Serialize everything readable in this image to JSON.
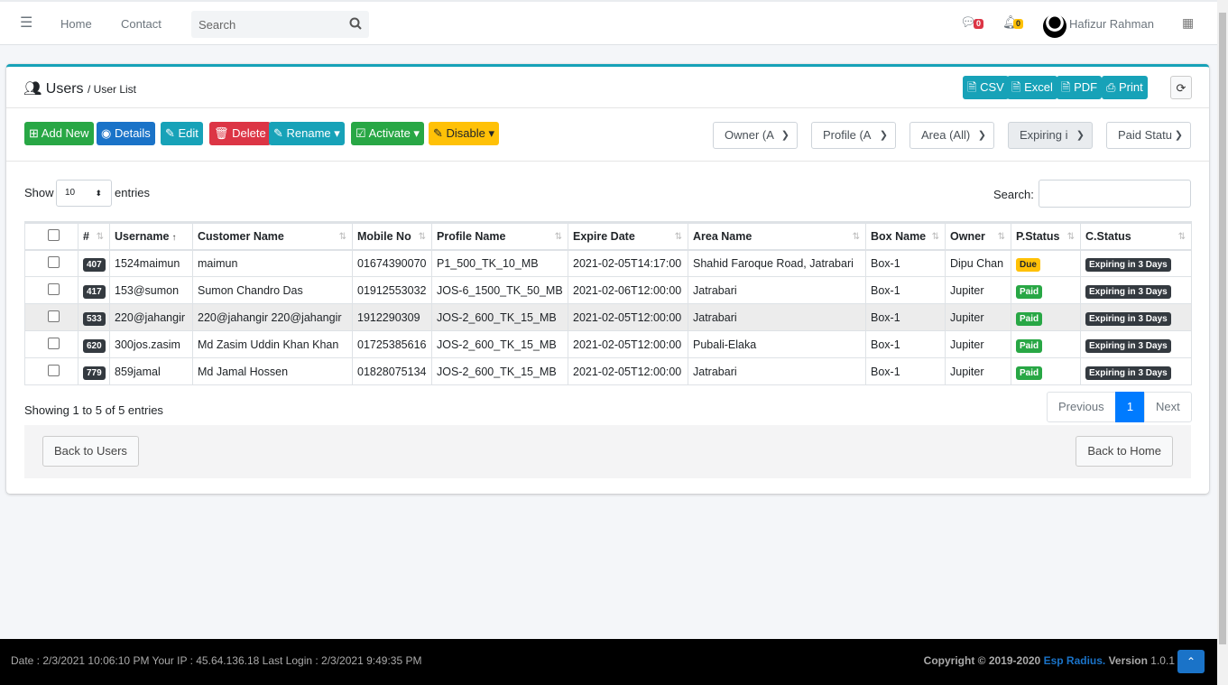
{
  "nav": {
    "home": "Home",
    "contact": "Contact",
    "search_placeholder": "Search",
    "messages_count": "0",
    "notifications_count": "0",
    "user_name": "Hafizur Rahman"
  },
  "header": {
    "title": "Users",
    "breadcrumb": "/ User List",
    "export": [
      "CSV",
      "Excel",
      "PDF",
      "Print"
    ]
  },
  "toolbar": {
    "add": "Add New",
    "details": "Details",
    "edit": "Edit",
    "delete": "Delete",
    "rename": "Rename",
    "activate": "Activate",
    "disable": "Disable"
  },
  "filters": [
    "Owner (A",
    "Profile (A",
    "Area (All)",
    "Expiring i",
    "Paid Statu"
  ],
  "table_controls": {
    "show": "Show",
    "entries_value": "10",
    "entries": "entries",
    "search_label": "Search:"
  },
  "columns": [
    "#",
    "Username",
    "Customer Name",
    "Mobile No",
    "Profile Name",
    "Expire Date",
    "Area Name",
    "Box Name",
    "Owner",
    "P.Status",
    "C.Status"
  ],
  "rows": [
    {
      "id": "407",
      "username": "1524maimun",
      "customer": "maimun",
      "mobile": "01674390070",
      "profile": "P1_500_TK_10_MB",
      "expire": "2021-02-05T14:17:00",
      "area": "Shahid Faroque Road, Jatrabari",
      "box": "Box-1",
      "owner": "Dipu Chan",
      "pstatus": "Due",
      "cstatus": "Expiring in 3 Days"
    },
    {
      "id": "417",
      "username": "153@sumon",
      "customer": "Sumon Chandro Das",
      "mobile": "01912553032",
      "profile": "JOS-6_1500_TK_50_MB",
      "expire": "2021-02-06T12:00:00",
      "area": "Jatrabari",
      "box": "Box-1",
      "owner": "Jupiter",
      "pstatus": "Paid",
      "cstatus": "Expiring in 3 Days"
    },
    {
      "id": "533",
      "username": "220@jahangir",
      "customer": "220@jahangir 220@jahangir",
      "mobile": "1912290309",
      "profile": "JOS-2_600_TK_15_MB",
      "expire": "2021-02-05T12:00:00",
      "area": "Jatrabari",
      "box": "Box-1",
      "owner": "Jupiter",
      "pstatus": "Paid",
      "cstatus": "Expiring in 3 Days"
    },
    {
      "id": "620",
      "username": "300jos.zasim",
      "customer": "Md Zasim Uddin Khan Khan",
      "mobile": "01725385616",
      "profile": "JOS-2_600_TK_15_MB",
      "expire": "2021-02-05T12:00:00",
      "area": "Pubali-Elaka",
      "box": "Box-1",
      "owner": "Jupiter",
      "pstatus": "Paid",
      "cstatus": "Expiring in 3 Days"
    },
    {
      "id": "779",
      "username": "859jamal",
      "customer": "Md Jamal Hossen",
      "mobile": "01828075134",
      "profile": "JOS-2_600_TK_15_MB",
      "expire": "2021-02-05T12:00:00",
      "area": "Jatrabari",
      "box": "Box-1",
      "owner": "Jupiter",
      "pstatus": "Paid",
      "cstatus": "Expiring in 3 Days"
    }
  ],
  "info": "Showing 1 to 5 of 5 entries",
  "pagination": {
    "previous": "Previous",
    "current": "1",
    "next": "Next"
  },
  "buttons": {
    "back_users": "Back to Users",
    "back_home": "Back to Home"
  },
  "footer": {
    "left": "Date : 2/3/2021 10:06:10 PM Your IP : 45.64.136.18 Last Login : 2/3/2021 9:49:35 PM",
    "copyright": "Copyright © 2019-2020",
    "brand": "Esp Radius.",
    "version_label": "Version",
    "version": "1.0.1"
  },
  "colors": {
    "accent": "#17a2b8",
    "due": "#ffc107",
    "paid": "#28a745",
    "brand": "#1a73c8"
  }
}
